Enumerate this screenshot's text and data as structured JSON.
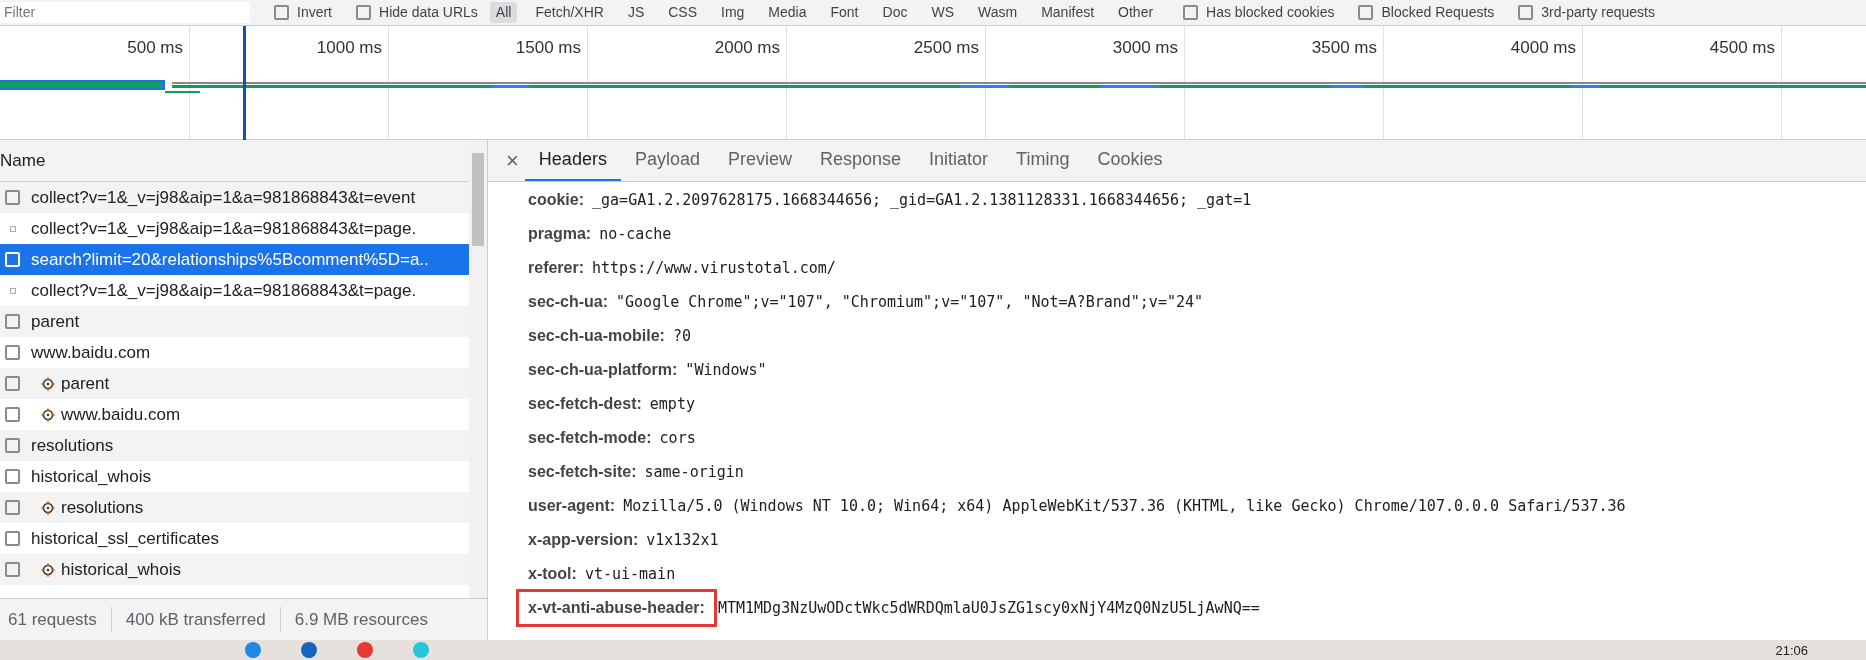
{
  "filter_bar": {
    "placeholder": "Filter",
    "options": [
      {
        "label": "Invert",
        "checked": false
      },
      {
        "label": "Hide data URLs",
        "checked": false
      }
    ],
    "types": [
      {
        "label": "All",
        "selected": true
      },
      {
        "label": "Fetch/XHR",
        "selected": false
      },
      {
        "label": "JS",
        "selected": false
      },
      {
        "label": "CSS",
        "selected": false
      },
      {
        "label": "Img",
        "selected": false
      },
      {
        "label": "Media",
        "selected": false
      },
      {
        "label": "Font",
        "selected": false
      },
      {
        "label": "Doc",
        "selected": false
      },
      {
        "label": "WS",
        "selected": false
      },
      {
        "label": "Wasm",
        "selected": false
      },
      {
        "label": "Manifest",
        "selected": false
      },
      {
        "label": "Other",
        "selected": false
      }
    ],
    "more_options": [
      {
        "label": "Has blocked cookies",
        "checked": false
      },
      {
        "label": "Blocked Requests",
        "checked": false
      },
      {
        "label": "3rd-party requests",
        "checked": false
      }
    ]
  },
  "timeline": {
    "ticks": [
      "500 ms",
      "1000 ms",
      "1500 ms",
      "2000 ms",
      "2500 ms",
      "3000 ms",
      "3500 ms",
      "4000 ms",
      "4500 ms"
    ]
  },
  "requests": {
    "header": "Name",
    "rows": [
      {
        "name": "collect?v=1&_v=j98&aip=1&a=981868843&t=event",
        "kind": "plain",
        "selected": false
      },
      {
        "name": "collect?v=1&_v=j98&aip=1&a=981868843&t=page.",
        "kind": "small",
        "selected": false
      },
      {
        "name": "search?limit=20&relationships%5Bcomment%5D=a..",
        "kind": "plain",
        "selected": true
      },
      {
        "name": "collect?v=1&_v=j98&aip=1&a=981868843&t=page.",
        "kind": "small",
        "selected": false
      },
      {
        "name": "parent",
        "kind": "plain",
        "selected": false
      },
      {
        "name": "www.baidu.com",
        "kind": "plain",
        "selected": false
      },
      {
        "name": "parent",
        "kind": "gear",
        "selected": false
      },
      {
        "name": "www.baidu.com",
        "kind": "gear",
        "selected": false
      },
      {
        "name": "resolutions",
        "kind": "plain",
        "selected": false
      },
      {
        "name": "historical_whois",
        "kind": "plain",
        "selected": false
      },
      {
        "name": "resolutions",
        "kind": "gear",
        "selected": false
      },
      {
        "name": "historical_ssl_certificates",
        "kind": "plain",
        "selected": false
      },
      {
        "name": "historical_whois",
        "kind": "gear",
        "selected": false
      }
    ],
    "summary": [
      "61 requests",
      "400 kB transferred",
      "6.9 MB resources"
    ]
  },
  "details": {
    "close": "×",
    "tabs": [
      {
        "label": "Headers",
        "selected": true
      },
      {
        "label": "Payload",
        "selected": false
      },
      {
        "label": "Preview",
        "selected": false
      },
      {
        "label": "Response",
        "selected": false
      },
      {
        "label": "Initiator",
        "selected": false
      },
      {
        "label": "Timing",
        "selected": false
      },
      {
        "label": "Cookies",
        "selected": false
      }
    ],
    "headers": [
      {
        "name": "cookie:",
        "value": "_ga=GA1.2.2097628175.1668344656; _gid=GA1.2.1381128331.1668344656; _gat=1",
        "highlighted": false
      },
      {
        "name": "pragma:",
        "value": "no-cache",
        "highlighted": false
      },
      {
        "name": "referer:",
        "value": "https://www.virustotal.com/",
        "highlighted": false
      },
      {
        "name": "sec-ch-ua:",
        "value": "\"Google Chrome\";v=\"107\", \"Chromium\";v=\"107\", \"Not=A?Brand\";v=\"24\"",
        "highlighted": false
      },
      {
        "name": "sec-ch-ua-mobile:",
        "value": "?0",
        "highlighted": false
      },
      {
        "name": "sec-ch-ua-platform:",
        "value": "\"Windows\"",
        "highlighted": false
      },
      {
        "name": "sec-fetch-dest:",
        "value": "empty",
        "highlighted": false
      },
      {
        "name": "sec-fetch-mode:",
        "value": "cors",
        "highlighted": false
      },
      {
        "name": "sec-fetch-site:",
        "value": "same-origin",
        "highlighted": false
      },
      {
        "name": "user-agent:",
        "value": "Mozilla/5.0 (Windows NT 10.0; Win64; x64) AppleWebKit/537.36 (KHTML, like Gecko) Chrome/107.0.0.0 Safari/537.36",
        "highlighted": false
      },
      {
        "name": "x-app-version:",
        "value": "v1x132x1",
        "highlighted": false
      },
      {
        "name": "x-tool:",
        "value": "vt-ui-main",
        "highlighted": false
      },
      {
        "name": "x-vt-anti-abuse-header:",
        "value": "MTM1MDg3NzUwODctWkc5dWRDQmlaU0JsZG1scy0xNjY4MzQ0NzU5LjAwNQ==",
        "highlighted": true
      }
    ]
  },
  "taskbar": {
    "time": "21:06"
  }
}
